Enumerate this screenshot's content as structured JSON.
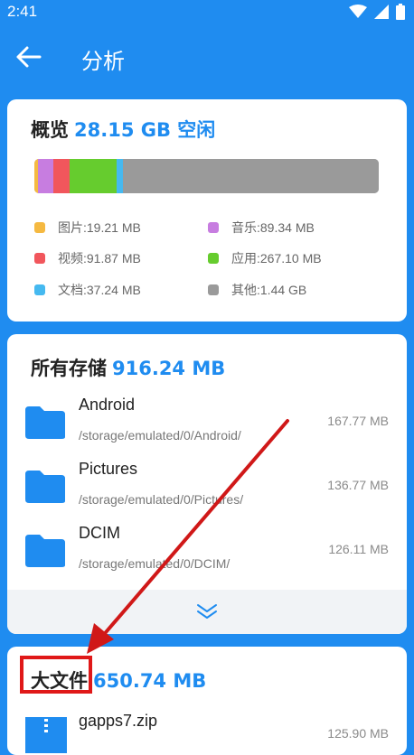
{
  "status_bar": {
    "time": "2:41"
  },
  "app_bar": {
    "title": "分析"
  },
  "overview": {
    "label": "概览",
    "free": "28.15 GB 空闲",
    "segments": [
      {
        "name": "图片",
        "fraction": 0.01,
        "color": "#f5b941"
      },
      {
        "name": "音乐",
        "fraction": 0.045,
        "color": "#c77de0"
      },
      {
        "name": "视频",
        "fraction": 0.047,
        "color": "#f1565c"
      },
      {
        "name": "应用",
        "fraction": 0.137,
        "color": "#66cc2e"
      },
      {
        "name": "文档",
        "fraction": 0.019,
        "color": "#45b9f0"
      },
      {
        "name": "其他",
        "fraction": 0.742,
        "color": "#9a9a9a"
      }
    ],
    "legend": [
      {
        "label": "图片:19.21 MB",
        "color": "#f5b941"
      },
      {
        "label": "音乐:89.34 MB",
        "color": "#c77de0"
      },
      {
        "label": "视频:91.87 MB",
        "color": "#f1565c"
      },
      {
        "label": "应用:267.10 MB",
        "color": "#66cc2e"
      },
      {
        "label": "文档:37.24 MB",
        "color": "#45b9f0"
      },
      {
        "label": "其他:1.44 GB",
        "color": "#9a9a9a"
      }
    ]
  },
  "all_storage": {
    "label": "所有存储",
    "total": "916.24 MB",
    "folders": [
      {
        "name": "Android",
        "path": "/storage/emulated/0/Android/",
        "size": "167.77 MB"
      },
      {
        "name": "Pictures",
        "path": "/storage/emulated/0/Pictures/",
        "size": "136.77 MB"
      },
      {
        "name": "DCIM",
        "path": "/storage/emulated/0/DCIM/",
        "size": "126.11 MB"
      }
    ]
  },
  "large_files": {
    "label": "大文件",
    "total": "650.74 MB",
    "files": [
      {
        "name": "gapps7.zip",
        "size": "125.90 MB"
      }
    ]
  },
  "colors": {
    "accent": "#1f8cf0",
    "annotation": "#e01818"
  }
}
